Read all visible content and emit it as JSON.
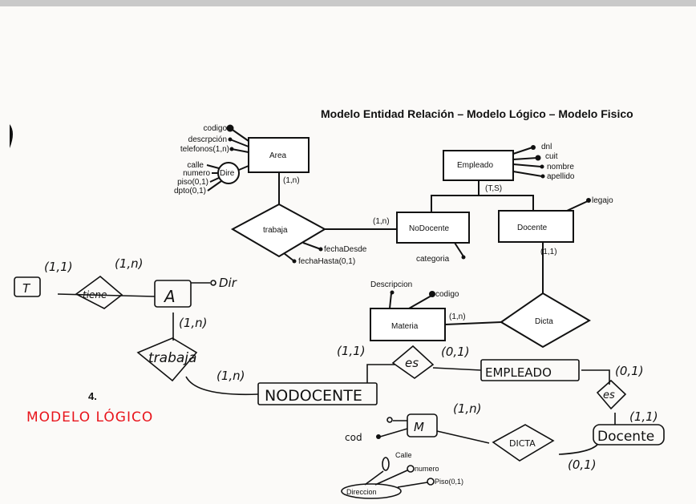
{
  "title": "Modelo Entidad Relación – Modelo Lógico – Modelo Fisico",
  "printed_er": {
    "area": {
      "name": "Area",
      "attrs": [
        "codigo",
        "descrpción",
        "telefonos(1,n)"
      ],
      "dire": "Dire",
      "dire_attrs": [
        "calle",
        "numero",
        "piso(0,1)",
        "dpto(0,1)"
      ],
      "card": "(1,n)"
    },
    "trabaja": {
      "name": "trabaja",
      "attrs": [
        "fechaDesde",
        "fechaHasta(0,1)"
      ],
      "card_nodocente": "(1,n)"
    },
    "empleado": {
      "name": "Empleado",
      "attrs": [
        "dnl",
        "cuit",
        "nombre",
        "apellido"
      ],
      "hierarchy": "(T,S)"
    },
    "nodocente": {
      "name": "NoDocente",
      "attr": "categoria"
    },
    "docente": {
      "name": "Docente",
      "attr": "legajo",
      "card": "(1,1)"
    },
    "materia": {
      "name": "Materia",
      "attrs": [
        "Descripcion",
        "codigo"
      ],
      "card": "(1,n)"
    },
    "dicta": {
      "name": "Dicta"
    }
  },
  "handwritten": {
    "t": "T",
    "tiene": "tiene",
    "card_t": "(1,1)",
    "card_a": "(1,n)",
    "a": "A",
    "dir": "Dir",
    "card_a_trabaja": "(1,n)",
    "trabaja": "trabaja",
    "card_nodocente": "(1,n)",
    "nodocente": "NODOCENTE",
    "card_es1": "(1,1)",
    "es1": "es",
    "card_empleado": "(0,1)",
    "empleado": "EMPLEADO",
    "card_empleado2": "(0,1)",
    "es2": "es",
    "card_docente": "(1,1)",
    "docente": "Docente",
    "card_m": "(1,n)",
    "m": "M",
    "cod": "cod",
    "dicta": "DICTA",
    "card_dicta": "(0,1)",
    "direccion": "Direccion",
    "dir_attrs": [
      "Calle",
      "numero",
      "Piso(0,1)"
    ]
  },
  "section_number": "4.",
  "section_label": "MODELO LÓGICO",
  "colors": {
    "ink": "#111111",
    "red_label": "#e8141b",
    "paper": "#fbfaf8"
  }
}
